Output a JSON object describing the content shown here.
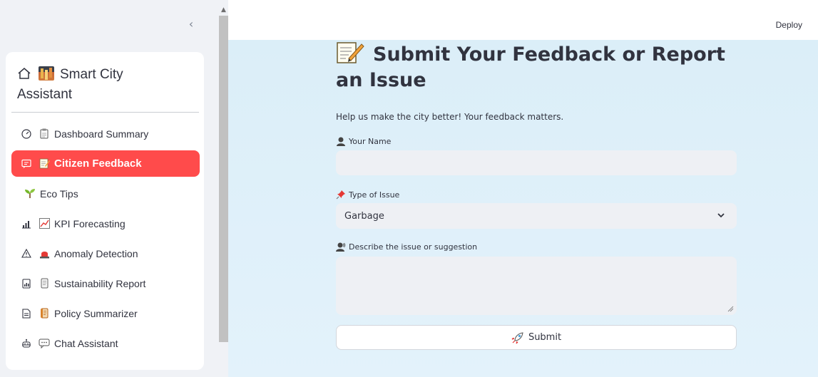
{
  "sidebar": {
    "collapse_glyph": "‹",
    "title_line1": "Smart City",
    "title_line2": "Assistant",
    "items": [
      {
        "label": "Dashboard Summary",
        "icon": "gauge-icon",
        "emoji": "clipboard-icon",
        "active": false
      },
      {
        "label": "Citizen Feedback",
        "icon": "chat-icon",
        "emoji": "memo-icon",
        "active": true
      },
      {
        "label": "Eco Tips",
        "icon": "",
        "emoji": "seedling-icon",
        "active": false
      },
      {
        "label": "KPI Forecasting",
        "icon": "bar-chart-icon",
        "emoji": "trending-up-icon",
        "active": false
      },
      {
        "label": "Anomaly Detection",
        "icon": "warning-icon",
        "emoji": "siren-icon",
        "active": false
      },
      {
        "label": "Sustainability Report",
        "icon": "report-icon",
        "emoji": "scroll-icon",
        "active": false
      },
      {
        "label": "Policy Summarizer",
        "icon": "document-icon",
        "emoji": "scroll-icon",
        "active": false
      },
      {
        "label": "Chat Assistant",
        "icon": "robot-icon",
        "emoji": "speech-bubble-icon",
        "active": false
      }
    ]
  },
  "header": {
    "deploy_label": "Deploy"
  },
  "main": {
    "title": "Submit Your Feedback or Report an Issue",
    "subtitle": "Help us make the city better! Your feedback matters.",
    "name_label": "Your Name",
    "name_value": "",
    "issue_label": "Type of Issue",
    "issue_selected": "Garbage",
    "description_label": "Describe the issue or suggestion",
    "description_value": "",
    "submit_label": "Submit"
  },
  "colors": {
    "accent": "#ff4b4b",
    "sidebar_bg": "#f0f2f6",
    "main_bg": "#dbeef8",
    "input_bg": "#eef0f4"
  }
}
